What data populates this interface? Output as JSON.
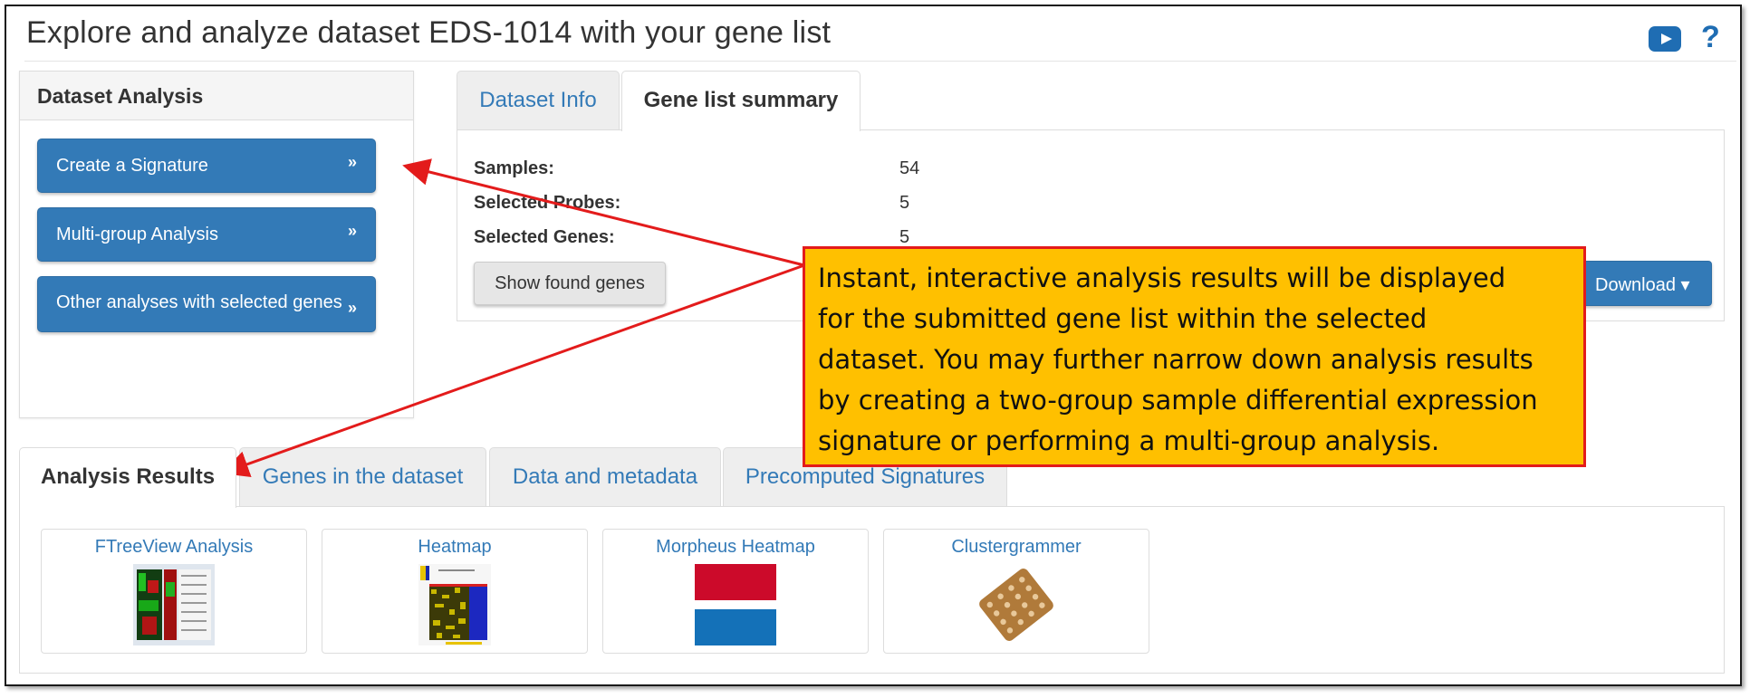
{
  "header": {
    "title": "Explore and analyze dataset EDS-1014 with your gene list",
    "video_icon": "youtube-icon",
    "help_label": "?"
  },
  "dataset_analysis": {
    "heading": "Dataset Analysis",
    "buttons": [
      {
        "label": "Create a Signature",
        "chevron": "»"
      },
      {
        "label": "Multi-group Analysis",
        "chevron": "»"
      },
      {
        "label": "Other analyses with selected genes",
        "chevron": "»"
      }
    ]
  },
  "top_tabs": [
    {
      "label": "Dataset Info",
      "active": false
    },
    {
      "label": "Gene list summary",
      "active": true
    }
  ],
  "summary": {
    "rows": [
      {
        "label": "Samples:",
        "value": "54"
      },
      {
        "label": "Selected Probes:",
        "value": "5"
      },
      {
        "label": "Selected Genes:",
        "value": "5"
      }
    ],
    "show_genes_label": "Show found genes",
    "download_label": "Download",
    "download_caret": "▾"
  },
  "bottom_tabs": [
    {
      "label": "Analysis Results",
      "active": true
    },
    {
      "label": "Genes in the dataset",
      "active": false
    },
    {
      "label": "Data and metadata",
      "active": false
    },
    {
      "label": "Precomputed Signatures",
      "active": false
    }
  ],
  "results": [
    {
      "title": "FTreeView Analysis",
      "icon": "ftreeview-thumbnail"
    },
    {
      "title": "Heatmap",
      "icon": "heatmap-thumbnail"
    },
    {
      "title": "Morpheus Heatmap",
      "icon": "morpheus-thumbnail"
    },
    {
      "title": "Clustergrammer",
      "icon": "clustergrammer-thumbnail"
    }
  ],
  "callout": {
    "lines": [
      "Instant, interactive analysis results will be displayed",
      "for the submitted gene list within the selected",
      "dataset. You may further narrow down analysis results",
      "by creating a two-group sample differential expression",
      "signature or performing a multi-group analysis."
    ]
  },
  "colors": {
    "primary": "#337ab7",
    "callout_bg": "#ffc000",
    "callout_border": "#e31b1b",
    "morpheus_red": "#cc0a2a",
    "morpheus_blue": "#1471b8",
    "cluster_brown": "#b07a3a"
  }
}
